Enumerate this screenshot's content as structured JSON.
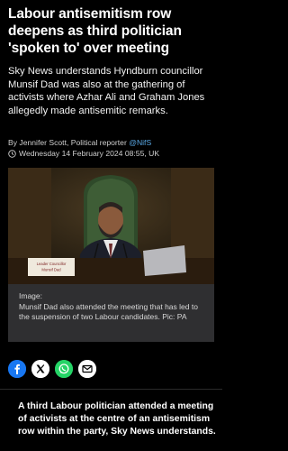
{
  "article": {
    "headline": "Labour antisemitism row deepens as third politician 'spoken to' over meeting",
    "standfirst": "Sky News understands Hyndburn councillor Munsif Dad was also at the gathering of activists where Azhar Ali and Graham Jones allegedly made antisemitic remarks.",
    "byline_prefix": "By Jennifer Scott, Political reporter ",
    "byline_handle": "@NifS",
    "date": "Wednesday 14 February 2024 08:55, UK",
    "image": {
      "nameplate_line1": "Leader Councillor",
      "nameplate_line2": "Munsif Dad"
    },
    "caption_label": "Image:",
    "caption": "Munsif Dad also attended the meeting that has led to the suspension of two Labour candidates. Pic: PA",
    "share": [
      {
        "icon": "facebook-icon",
        "label": "f",
        "color": "#1877f2"
      },
      {
        "icon": "x-icon",
        "label": "𝕏",
        "color": "#ffffff"
      },
      {
        "icon": "whatsapp-icon",
        "label": "",
        "color": "#25d366"
      },
      {
        "icon": "email-icon",
        "label": "",
        "color": "#ffffff"
      }
    ],
    "lead": "A third Labour politician attended a meeting of activists at the centre of an antisemitism row within the party, Sky News understands."
  }
}
